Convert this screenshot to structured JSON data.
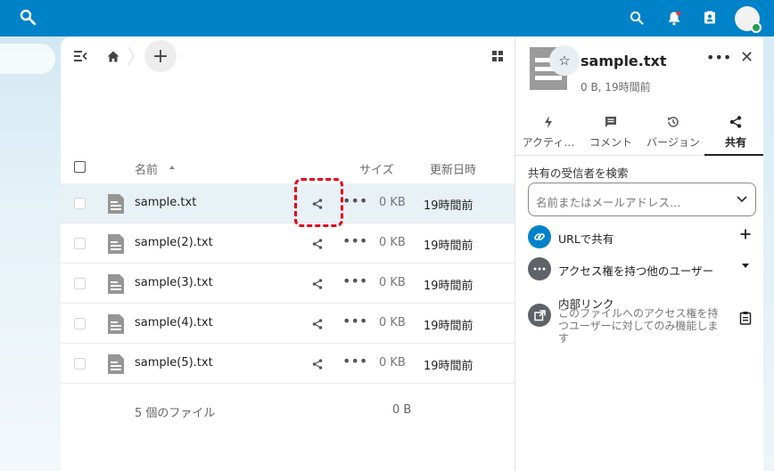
{
  "main": {
    "columns": {
      "name": "名前",
      "size": "サイズ",
      "modified": "更新日時"
    },
    "files": [
      {
        "name": "sample.txt",
        "size": "0 KB",
        "modified": "19時間前",
        "selected": true
      },
      {
        "name": "sample(2).txt",
        "size": "0 KB",
        "modified": "19時間前",
        "selected": false
      },
      {
        "name": "sample(3).txt",
        "size": "0 KB",
        "modified": "19時間前",
        "selected": false
      },
      {
        "name": "sample(4).txt",
        "size": "0 KB",
        "modified": "19時間前",
        "selected": false
      },
      {
        "name": "sample(5).txt",
        "size": "0 KB",
        "modified": "19時間前",
        "selected": false
      }
    ],
    "summary": {
      "count": "5 個のファイル",
      "total": "0 B"
    },
    "add_label": "+"
  },
  "sidebar": {
    "file_name": "sample.txt",
    "meta": "0 B, 19時間前",
    "tabs": [
      {
        "label": "アクティ…",
        "icon": "activity-icon"
      },
      {
        "label": "コメント",
        "icon": "comment-icon"
      },
      {
        "label": "バージョン",
        "icon": "history-icon"
      },
      {
        "label": "共有",
        "icon": "share-icon",
        "active": true
      }
    ],
    "share_search_label": "共有の受信者を検索",
    "share_search_placeholder": "名前またはメールアドレス…",
    "url_share": "URLで共有",
    "others_access": "アクセス権を持つ他のユーザー",
    "internal_link": {
      "title": "内部リンク",
      "description": "このファイルへのアクセス権を持つユーザーに対してのみ機能します"
    }
  },
  "colors": {
    "topbar": "#0082c9",
    "link_circle": "#0082c9",
    "gray_circle": "#5f6266",
    "highlight": "#e5001b",
    "selected_row": "#e8f1f6"
  }
}
